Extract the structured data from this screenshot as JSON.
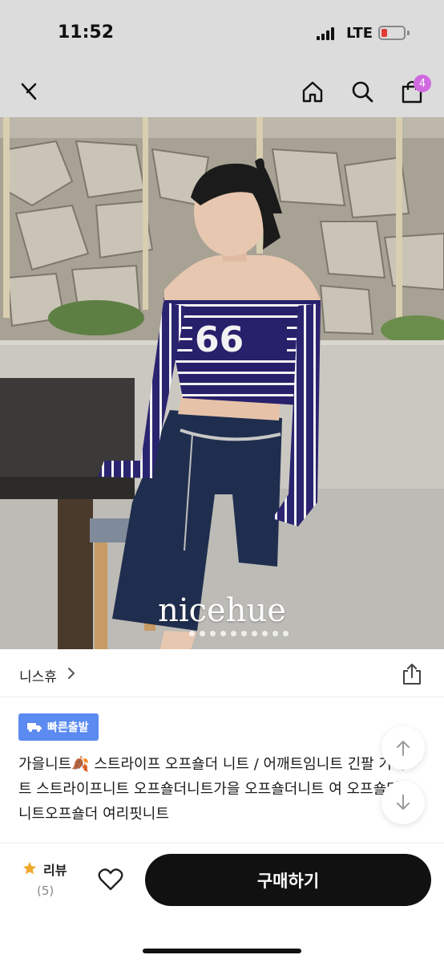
{
  "status": {
    "time": "11:52",
    "carrier": "LTE"
  },
  "nav": {
    "cart_count": "4"
  },
  "image": {
    "brand_watermark": "nicehue"
  },
  "seller": {
    "name": "니스휴"
  },
  "product": {
    "badge": "빠른출발",
    "title": "가을니트🍂 스트라이프 오프숄더 니트 / 어깨트임니트 긴팔 기니트 스트라이프니트 오프숄더니트가을 오프숄더니트 여 오프숄더 니트오프숄더 여리핏니트"
  },
  "bottom": {
    "review_label": "리뷰",
    "review_count": "(5)",
    "buy_label": "구매하기"
  },
  "colors": {
    "badge_blue": "#5b8af0",
    "cart_badge": "#cf6adf",
    "buy_button": "#111111",
    "battery_low": "#e53935"
  }
}
